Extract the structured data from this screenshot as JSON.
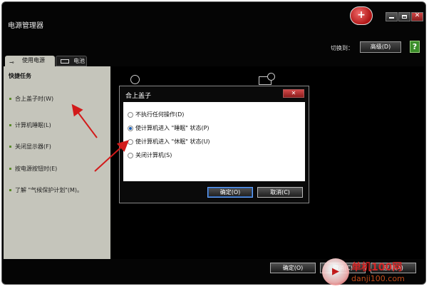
{
  "window": {
    "title": "电源管理器"
  },
  "toolbar": {
    "switch_label": "切换到：",
    "switch_value": "高级(D)",
    "help_icon": "?"
  },
  "tabs": [
    {
      "label": "使用电源",
      "icon": "plug-icon"
    },
    {
      "label": "电池",
      "icon": "battery-icon"
    }
  ],
  "sidebar": {
    "heading": "快捷任务",
    "items": [
      {
        "label": "合上盖子时(W)"
      },
      {
        "label": "计算机睡眠(L)"
      },
      {
        "label": "关闭显示器(F)"
      },
      {
        "label": "按电源按钮时(E)"
      },
      {
        "label": "了解 \"气候保护计划\"(M)。"
      }
    ]
  },
  "dialog": {
    "title": "合上盖子",
    "close_label": "✕",
    "options": [
      {
        "label": "不执行任何操作(D)",
        "selected": false
      },
      {
        "label": "使计算机进入 \"睡眠\" 状态(P)",
        "selected": true
      },
      {
        "label": "使计算机进入 \"休眠\" 状态(U)",
        "selected": false
      },
      {
        "label": "关闭计算机(S)",
        "selected": false
      }
    ],
    "ok_label": "确定(O)",
    "cancel_label": "取消(C)"
  },
  "footer": {
    "ok_label": "确定(O)",
    "cancel_label": "取消(C)",
    "apply_label": "应用(A)"
  },
  "watermark": {
    "line1": "单机100网",
    "line2": "danji100.com"
  },
  "colors": {
    "background": "#050505",
    "sidebar": "#c5c5bb",
    "accent_red": "#d21a1a",
    "radio_selected": "#1a5fb4"
  }
}
